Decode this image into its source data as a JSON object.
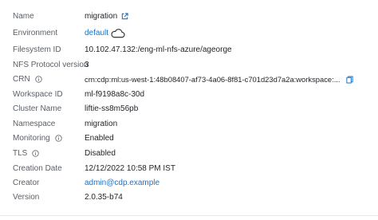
{
  "details": {
    "rows": [
      {
        "label": "Name",
        "value": "migration"
      },
      {
        "label": "Environment",
        "value": "default"
      },
      {
        "label": "Filesystem ID",
        "value": "10.102.47.132:/eng-ml-nfs-azure/ageorge"
      },
      {
        "label": "NFS Protocol version",
        "value": "3"
      },
      {
        "label": "CRN",
        "value": "crn:cdp:ml:us-west-1:48b08407-af73-4a06-8f81-c701d23d7a2a:workspace:..."
      },
      {
        "label": "Workspace ID",
        "value": "ml-f9198a8c-30d"
      },
      {
        "label": "Cluster Name",
        "value": "liftie-ss8m56pb"
      },
      {
        "label": "Namespace",
        "value": "migration"
      },
      {
        "label": "Monitoring",
        "value": "Enabled"
      },
      {
        "label": "TLS",
        "value": "Disabled"
      },
      {
        "label": "Creation Date",
        "value": "12/12/2022 10:58 PM IST"
      },
      {
        "label": "Creator",
        "value": "admin@cdp.example"
      },
      {
        "label": "Version",
        "value": "2.0.35-b74"
      }
    ]
  },
  "icons": {
    "name_link": "external-link-icon",
    "environment": "cloud-icon",
    "crn_info": "info-circle-icon",
    "crn_copy": "copy-icon",
    "monitoring_info": "info-circle-icon",
    "tls_info": "info-circle-icon"
  },
  "colors": {
    "link": "#1a73c8",
    "label": "#5a6067",
    "value": "#1e2226"
  }
}
